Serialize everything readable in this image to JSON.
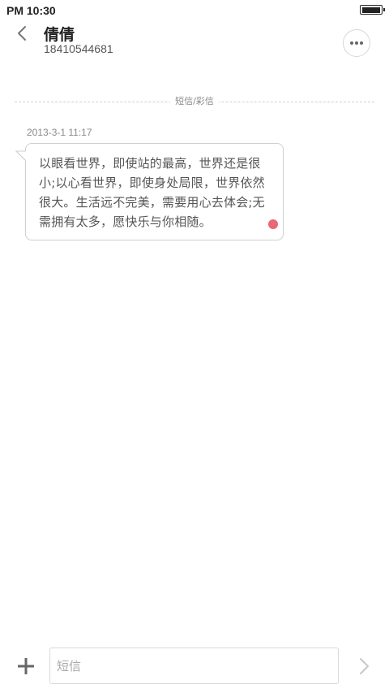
{
  "status_bar": {
    "time": "PM 10:30",
    "battery_level": 1.0
  },
  "header": {
    "contact_name": "倩倩",
    "contact_number": "18410544681"
  },
  "divider": {
    "label": "短信/彩信"
  },
  "messages": [
    {
      "timestamp": "2013-3-1 11:17",
      "text": "以眼看世界，即使站的最高，世界还是很小;以心看世界，即使身处局限，世界依然很大。生活远不完美，需要用心去体会;无需拥有太多，愿快乐与你相随。",
      "unread": true
    }
  ],
  "input_bar": {
    "placeholder": "短信"
  },
  "colors": {
    "unread_dot": "#e8687b",
    "icon_gray": "#666666",
    "send_disabled": "#c8c8c8"
  },
  "icons": {
    "back": "chevron-left-icon",
    "more": "more-dots-icon",
    "add": "plus-icon",
    "send": "chevron-right-icon"
  }
}
